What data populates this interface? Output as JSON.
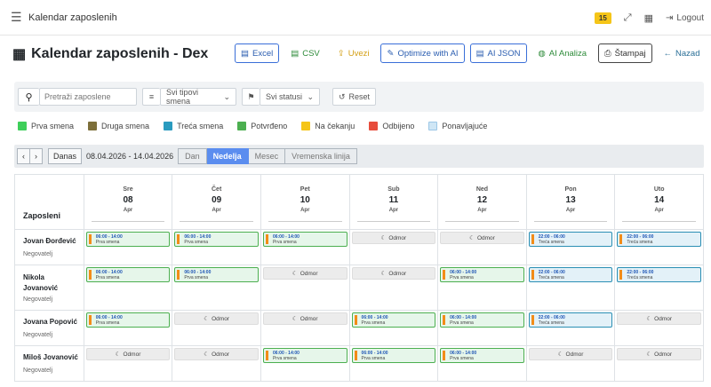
{
  "topbar": {
    "title": "Kalendar zaposlenih",
    "badge": "15",
    "logout": "Logout"
  },
  "page": {
    "title": "Kalendar zaposlenih - Dex"
  },
  "actions": {
    "excel": "Excel",
    "csv": "CSV",
    "uvezi": "Uvezi",
    "optimize": "Optimize with AI",
    "ai_json": "AI JSON",
    "ai_analiza": "AI Analiza",
    "stampaj": "Štampaj",
    "nazad": "Nazad"
  },
  "filters": {
    "search_placeholder": "Pretraži zaposlene",
    "shift_type": "Svi tipovi smena",
    "status": "Svi statusi",
    "reset": "Reset"
  },
  "legend": [
    {
      "label": "Prva smena",
      "color": "#3ecf5a"
    },
    {
      "label": "Druga smena",
      "color": "#7d6f3a"
    },
    {
      "label": "Treća smena",
      "color": "#2a9bbf"
    },
    {
      "label": "Potvrđeno",
      "color": "#4caf50"
    },
    {
      "label": "Na čekanju",
      "color": "#f5c518"
    },
    {
      "label": "Odbijeno",
      "color": "#e74c3c"
    },
    {
      "label": "Ponavljajuće",
      "color": "#cfe6f5"
    }
  ],
  "nav": {
    "prev": "‹",
    "next": "›",
    "today": "Danas",
    "range": "08.04.2026 - 14.04.2026",
    "views": [
      "Dan",
      "Nedelja",
      "Mesec",
      "Vremenska linija"
    ],
    "active_view": "Nedelja"
  },
  "calendar": {
    "employees_header": "Zaposleni",
    "days": [
      {
        "name": "Sre",
        "date": "08",
        "month": "Apr"
      },
      {
        "name": "Čet",
        "date": "09",
        "month": "Apr"
      },
      {
        "name": "Pet",
        "date": "10",
        "month": "Apr"
      },
      {
        "name": "Sub",
        "date": "11",
        "month": "Apr"
      },
      {
        "name": "Ned",
        "date": "12",
        "month": "Apr"
      },
      {
        "name": "Pon",
        "date": "13",
        "month": "Apr"
      },
      {
        "name": "Uto",
        "date": "14",
        "month": "Apr"
      }
    ],
    "employees": [
      {
        "name": "Jovan Đorđević",
        "role": "Negovatelj",
        "cells": [
          {
            "type": "first",
            "time": "06:00 - 14:00",
            "label": "Prva smena"
          },
          {
            "type": "first",
            "time": "06:00 - 14:00",
            "label": "Prva smena"
          },
          {
            "type": "first",
            "time": "06:00 - 14:00",
            "label": "Prva smena"
          },
          {
            "type": "off",
            "label": "Odmor"
          },
          {
            "type": "off",
            "label": "Odmor"
          },
          {
            "type": "third",
            "time": "22:00 - 06:00",
            "label": "Treća smena"
          },
          {
            "type": "third",
            "time": "22:00 - 06:00",
            "label": "Treća smena"
          }
        ]
      },
      {
        "name": "Nikola Jovanović",
        "role": "Negovatelj",
        "cells": [
          {
            "type": "first",
            "time": "06:00 - 14:00",
            "label": "Prva smena"
          },
          {
            "type": "first",
            "time": "06:00 - 14:00",
            "label": "Prva smena"
          },
          {
            "type": "off",
            "label": "Odmor"
          },
          {
            "type": "off",
            "label": "Odmor"
          },
          {
            "type": "first",
            "time": "06:00 - 14:00",
            "label": "Prva smena"
          },
          {
            "type": "third",
            "time": "22:00 - 06:00",
            "label": "Treća smena"
          },
          {
            "type": "third",
            "time": "22:00 - 06:00",
            "label": "Treća smena"
          }
        ]
      },
      {
        "name": "Jovana Popović",
        "role": "Negovatelj",
        "cells": [
          {
            "type": "first",
            "time": "06:00 - 14:00",
            "label": "Prva smena"
          },
          {
            "type": "off",
            "label": "Odmor"
          },
          {
            "type": "off",
            "label": "Odmor"
          },
          {
            "type": "first",
            "time": "06:00 - 14:00",
            "label": "Prva smena"
          },
          {
            "type": "first",
            "time": "06:00 - 14:00",
            "label": "Prva smena"
          },
          {
            "type": "third",
            "time": "22:00 - 06:00",
            "label": "Treća smena"
          },
          {
            "type": "off",
            "label": "Odmor"
          }
        ]
      },
      {
        "name": "Miloš Jovanović",
        "role": "Negovatelj",
        "cells": [
          {
            "type": "off",
            "label": "Odmor"
          },
          {
            "type": "off",
            "label": "Odmor"
          },
          {
            "type": "first",
            "time": "06:00 - 14:00",
            "label": "Prva smena"
          },
          {
            "type": "first",
            "time": "06:00 - 14:00",
            "label": "Prva smena"
          },
          {
            "type": "first",
            "time": "06:00 - 14:00",
            "label": "Prva smena"
          },
          {
            "type": "off",
            "label": "Odmor"
          },
          {
            "type": "off",
            "label": "Odmor"
          }
        ]
      }
    ]
  }
}
